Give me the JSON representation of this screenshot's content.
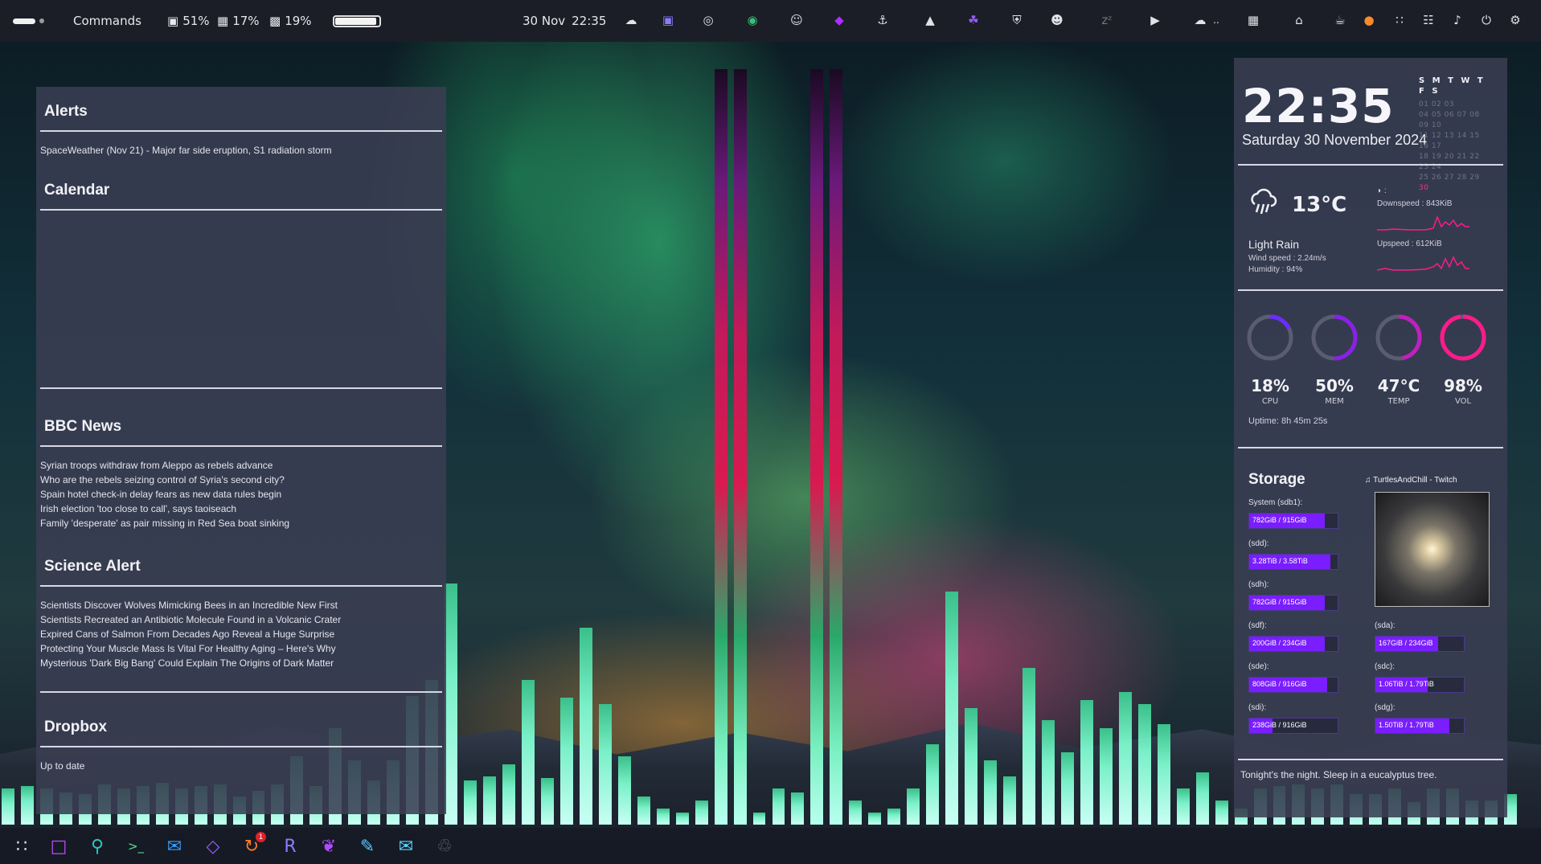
{
  "topbar": {
    "commands_label": "Commands",
    "battery1": "51%",
    "cpu_label": "17%",
    "disk_label": "19%",
    "battery_level": 0.95,
    "date": "30 Nov",
    "time": "22:35",
    "tray_icons": [
      "weather-icon",
      "ghost-icon",
      "target-icon",
      "git-icon",
      "discord-icon",
      "app-icon",
      "docker-icon",
      "network-icon",
      "tree-icon",
      "shield-icon",
      "face-icon",
      "sleep-icon",
      "media-play-icon",
      "cloud-icon",
      "layout-icon",
      "home-icon",
      "coffee-icon",
      "microphone-icon",
      "apps-grid-icon",
      "network-tree-icon",
      "volume-icon",
      "power-icon",
      "settings-icon"
    ],
    "tray_more": ".."
  },
  "left": {
    "alerts_title": "Alerts",
    "alerts_text": "SpaceWeather (Nov 21) - Major far side eruption, S1 radiation storm",
    "calendar_title": "Calendar",
    "bbc_title": "BBC News",
    "bbc_items": [
      "Syrian troops withdraw from Aleppo as rebels advance",
      "Who are the rebels seizing control of Syria's second city?",
      "Spain hotel check-in delay fears as new data rules begin",
      "Irish election 'too close to call', says taoiseach",
      "Family 'desperate' as pair missing in Red Sea boat sinking"
    ],
    "science_title": "Science Alert",
    "science_items": [
      "Scientists Discover Wolves Mimicking Bees in an Incredible New First",
      "Scientists Recreated an Antibiotic Molecule Found in a Volcanic Crater",
      "Expired Cans of Salmon From Decades Ago Reveal a Huge Surprise",
      "Protecting Your Muscle Mass Is Vital For Healthy Aging – Here's Why",
      "Mysterious 'Dark Big Bang' Could Explain The Origins of Dark Matter"
    ],
    "dropbox_title": "Dropbox",
    "dropbox_status": "Up to date"
  },
  "right": {
    "clock": "22:35",
    "date": "Saturday 30 November 2024",
    "cal_header": "S M T W T F S",
    "cal_rows": [
      "01 02 03",
      "04 05 06 07 08 09 10",
      "11 12 13 14 15 16 17",
      "18 19 20 21 22 23 24",
      "25 26 27 28 29"
    ],
    "cal_today": "30",
    "temp": "13°C",
    "condition": "Light Rain",
    "wind": "Wind speed : 2.24m/s",
    "humidity": "Humidity : 94%",
    "net_icon": "◗ :",
    "downspeed": "Downspeed : 843KiB",
    "upspeed": "Upspeed : 612KiB",
    "gauges": [
      {
        "value": "18%",
        "label": "CPU",
        "fraction": 0.18,
        "color": "#6a2dff"
      },
      {
        "value": "50%",
        "label": "MEM",
        "fraction": 0.5,
        "color": "#8a20e8"
      },
      {
        "value": "47°C",
        "label": "TEMP",
        "fraction": 0.47,
        "color": "#c21fbf"
      },
      {
        "value": "98%",
        "label": "VOL",
        "fraction": 0.98,
        "color": "#ff1a8c"
      }
    ],
    "uptime": "Uptime: 8h 45m 25s",
    "storage_title": "Storage",
    "twitch": "♫ TurtlesAndChill - Twitch",
    "disks_left": [
      {
        "name": "System (sdb1):",
        "text": "782GiB / 915GiB",
        "fraction": 0.85
      },
      {
        "name": "(sdd):",
        "text": "3.28TiB / 3.58TiB",
        "fraction": 0.92
      },
      {
        "name": "(sdh):",
        "text": "782GiB / 915GiB",
        "fraction": 0.85
      },
      {
        "name": "(sdf):",
        "text": "200GiB / 234GiB",
        "fraction": 0.85
      },
      {
        "name": "(sde):",
        "text": "808GiB / 916GiB",
        "fraction": 0.88
      },
      {
        "name": "(sdi):",
        "text": "238GiB / 916GiB",
        "fraction": 0.26
      }
    ],
    "disks_right": [
      {
        "name": "(sda):",
        "text": "167GiB / 234GiB",
        "fraction": 0.71
      },
      {
        "name": "(sdc):",
        "text": "1.06TiB / 1.79TiB",
        "fraction": 0.59
      },
      {
        "name": "(sdg):",
        "text": "1.50TiB / 1.79TiB",
        "fraction": 0.84
      }
    ],
    "quote": "Tonight's the night. Sleep in a eucalyptus tree."
  },
  "dock": {
    "icons": [
      "app-grid-icon",
      "folder-icon",
      "search-icon",
      "terminal-icon",
      "mail-icon",
      "obsidian-icon",
      "update-icon",
      "r-icon",
      "chat-icon",
      "edit-icon",
      "message-icon",
      "trash-icon"
    ],
    "update_badge": "1"
  },
  "colors": {
    "accent": "#7a1dff",
    "pink": "#ff1a8c",
    "panel": "#3a3e52"
  }
}
